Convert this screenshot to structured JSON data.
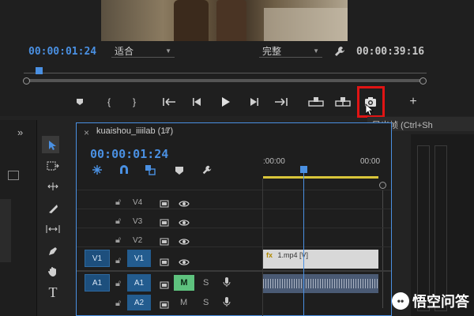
{
  "monitor": {
    "current_timecode": "00:00:01:24",
    "fit_dropdown": "适合",
    "quality_dropdown": "完整",
    "duration_timecode": "00:00:39:16",
    "settings_icon": "wrench-icon"
  },
  "transport": {
    "buttons": [
      {
        "name": "add-marker-button",
        "glyph": "▼"
      },
      {
        "name": "mark-in-button",
        "glyph": "{"
      },
      {
        "name": "mark-out-button",
        "glyph": "}"
      },
      {
        "name": "go-to-in-button",
        "glyph": "{←"
      },
      {
        "name": "step-back-button",
        "glyph": "◀|"
      },
      {
        "name": "play-button",
        "glyph": "▶"
      },
      {
        "name": "step-forward-button",
        "glyph": "|▶"
      },
      {
        "name": "go-to-out-button",
        "glyph": "→}"
      },
      {
        "name": "lift-button",
        "glyph": "⊞"
      },
      {
        "name": "extract-button",
        "glyph": "⊟"
      },
      {
        "name": "export-frame-button",
        "glyph": "📷"
      },
      {
        "name": "button-editor-button",
        "glyph": "+"
      }
    ],
    "tooltip": "导出帧 (Ctrl+Sh"
  },
  "timeline": {
    "sequence_name": "kuaishou_iiiilab (17)",
    "timecode": "00:00:01:24",
    "ruler_labels": [
      ":00:00",
      "00:00"
    ],
    "video_tracks": [
      {
        "name": "V4"
      },
      {
        "name": "V3"
      },
      {
        "name": "V2"
      },
      {
        "name": "V1",
        "source": "V1"
      }
    ],
    "audio_tracks": [
      {
        "name": "A1",
        "source": "A1",
        "mute": "M",
        "solo": "S"
      },
      {
        "name": "A2",
        "mute": "M",
        "solo": "S"
      }
    ],
    "video_clip_label": "1.mp4 [V]",
    "video_clip_fx": "fx"
  },
  "tools": [
    "selection",
    "track-select",
    "ripple-edit",
    "razor",
    "slip",
    "pen",
    "hand",
    "type"
  ],
  "watermark": "悟空问答",
  "colors": {
    "accent_blue": "#4a90e2",
    "highlight_red": "#e01414",
    "mute_green": "#5ec27e",
    "work_area_yellow": "#d9c53a"
  }
}
